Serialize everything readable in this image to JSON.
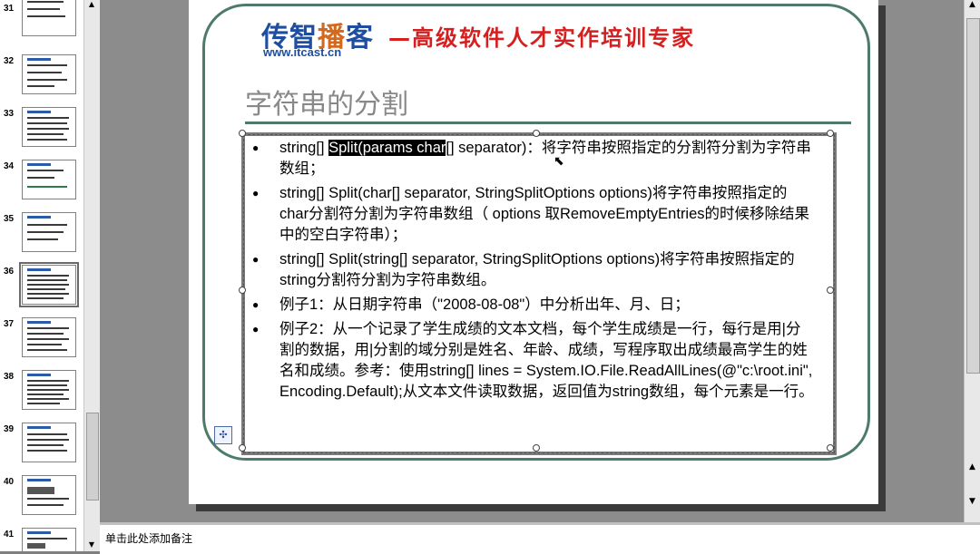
{
  "thumbnails": [
    {
      "num": "31"
    },
    {
      "num": "32"
    },
    {
      "num": "33"
    },
    {
      "num": "34"
    },
    {
      "num": "35"
    },
    {
      "num": "36",
      "selected": true
    },
    {
      "num": "37"
    },
    {
      "num": "38"
    },
    {
      "num": "39"
    },
    {
      "num": "40"
    },
    {
      "num": "41"
    }
  ],
  "slide": {
    "logo_text_a": "传智",
    "logo_text_b": "播",
    "logo_text_c": "客",
    "logo_url": "www.itcast.cn",
    "slogan": "—高级软件人才实作培训专家",
    "title": "字符串的分割",
    "bullets": {
      "b1_pre": "string[] ",
      "b1_sel": "Split(params char",
      "b1_post": "[] separator)：将字符串按照指定的分割符分割为字符串数组；",
      "b2": "string[] Split(char[] separator, StringSplitOptions options)将字符串按照指定的char分割符分割为字符串数组（ options 取RemoveEmptyEntries的时候移除结果中的空白字符串）；",
      "b3": "string[] Split(string[] separator, StringSplitOptions options)将字符串按照指定的string分割符分割为字符串数组。",
      "b4": "例子1：从日期字符串（\"2008-08-08\"）中分析出年、月、日；",
      "b5": "例子2：从一个记录了学生成绩的文本文档，每个学生成绩是一行，每行是用|分割的数据，用|分割的域分别是姓名、年龄、成绩，写程序取出成绩最高学生的姓名和成绩。参考：使用string[] lines = System.IO.File.ReadAllLines(@\"c:\\root.ini\", Encoding.Default);从文本文件读取数据，返回值为string数组，每个元素是一行。"
    }
  },
  "notes": {
    "placeholder": "单击此处添加备注"
  },
  "colors": {
    "frame": "#4d7a6b",
    "logo_blue": "#1f4ea0",
    "slogan_red": "#d62020",
    "title_gray": "#888888"
  },
  "icons": {
    "autofit": "autofit-options-icon",
    "cursor": "mouse-cursor-icon"
  }
}
